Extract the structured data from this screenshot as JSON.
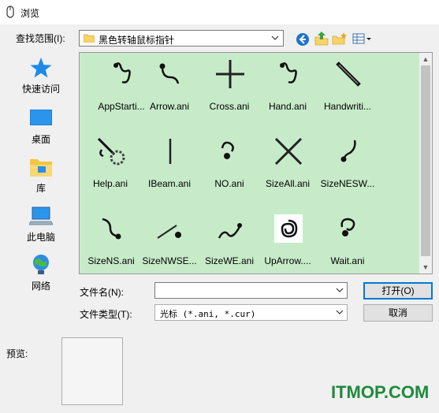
{
  "window": {
    "title": "浏览"
  },
  "lookin": {
    "label": "查找范围(I):",
    "value": "黑色转轴鼠标指针"
  },
  "toolbar": {
    "back_icon": "back-arrow-icon",
    "up_icon": "up-folder-icon",
    "new_folder_icon": "new-folder-icon",
    "view_icon": "view-menu-icon"
  },
  "places": [
    {
      "label": "快速访问",
      "icon": "star-icon"
    },
    {
      "label": "桌面",
      "icon": "desktop-icon"
    },
    {
      "label": "库",
      "icon": "library-icon"
    },
    {
      "label": "此电脑",
      "icon": "computer-icon"
    },
    {
      "label": "网络",
      "icon": "network-icon"
    }
  ],
  "files": [
    {
      "name": "AppStarti...",
      "icon": "cursor-appstarting-icon"
    },
    {
      "name": "Arrow.ani",
      "icon": "cursor-arrow-icon"
    },
    {
      "name": "Cross.ani",
      "icon": "cursor-cross-icon"
    },
    {
      "name": "Hand.ani",
      "icon": "cursor-hand-icon"
    },
    {
      "name": "Handwriti...",
      "icon": "cursor-handwriting-icon"
    },
    {
      "name": "Help.ani",
      "icon": "cursor-help-icon"
    },
    {
      "name": "IBeam.ani",
      "icon": "cursor-ibeam-icon"
    },
    {
      "name": "NO.ani",
      "icon": "cursor-no-icon"
    },
    {
      "name": "SizeAll.ani",
      "icon": "cursor-sizeall-icon"
    },
    {
      "name": "SizeNESW...",
      "icon": "cursor-sizenesw-icon"
    },
    {
      "name": "SizeNS.ani",
      "icon": "cursor-sizens-icon"
    },
    {
      "name": "SizeNWSE...",
      "icon": "cursor-sizenwse-icon"
    },
    {
      "name": "SizeWE.ani",
      "icon": "cursor-sizewe-icon"
    },
    {
      "name": "UpArrow....",
      "icon": "cursor-uparrow-icon"
    },
    {
      "name": "Wait.ani",
      "icon": "cursor-wait-icon"
    }
  ],
  "filename": {
    "label": "文件名(N):",
    "value": ""
  },
  "filetype": {
    "label": "文件类型(T):",
    "value": "光标 (*.ani, *.cur)"
  },
  "buttons": {
    "open": "打开(O)",
    "cancel": "取消"
  },
  "preview": {
    "label": "预览:"
  },
  "watermark": "ITMOP.COM",
  "colors": {
    "file_area_bg": "#c7ebc9",
    "watermark": "#1e8a3c",
    "accent": "#0078d7"
  }
}
